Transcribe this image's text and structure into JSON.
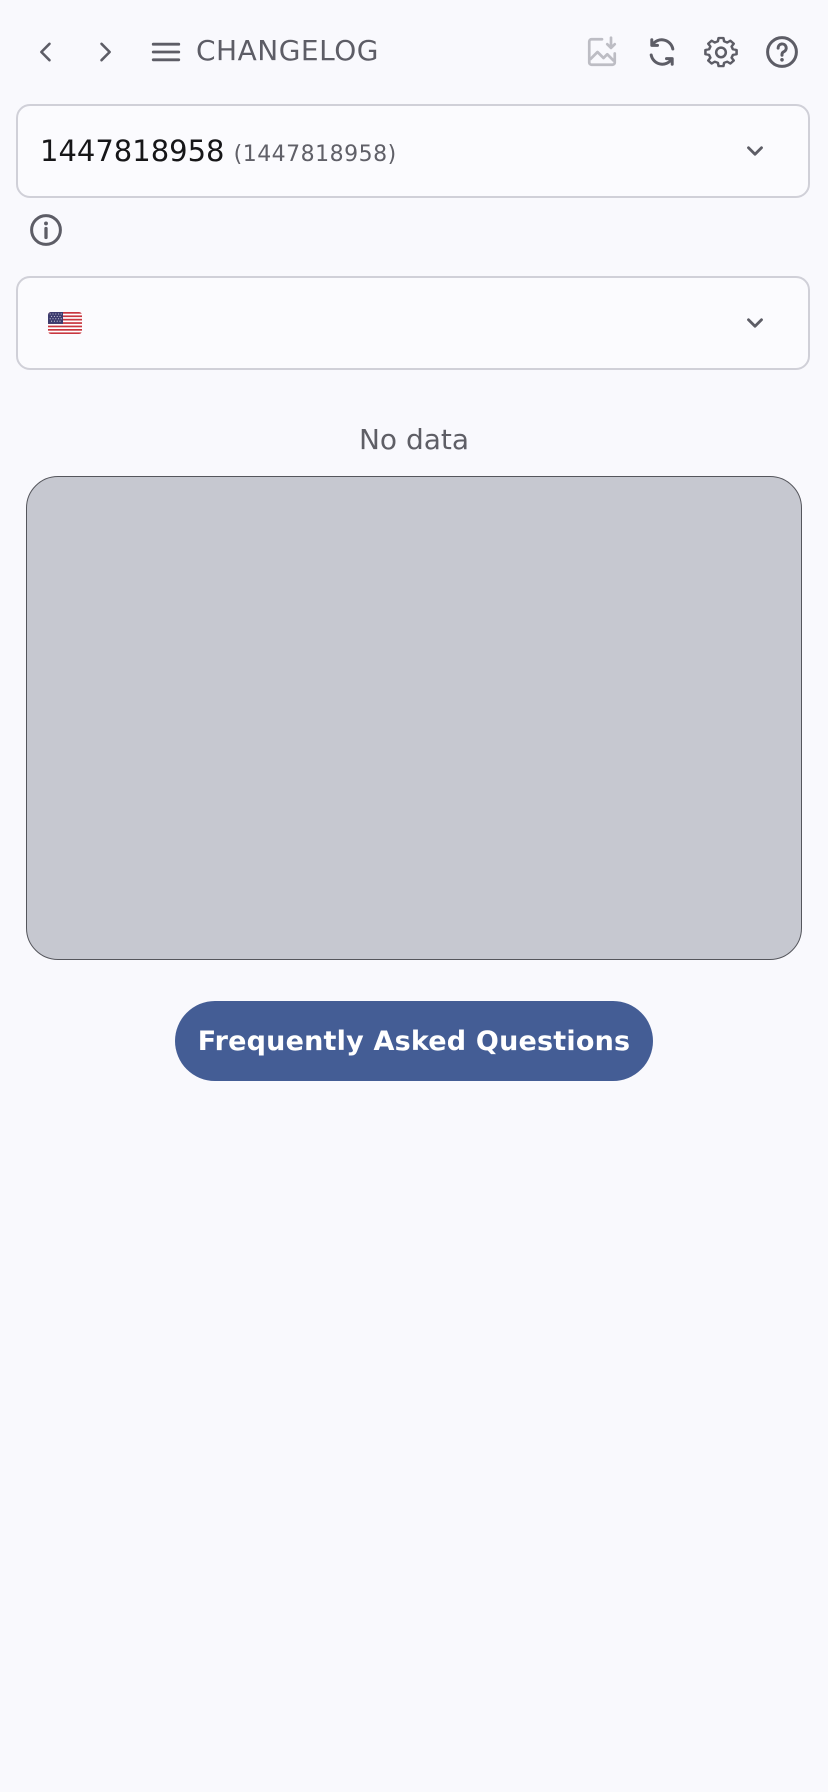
{
  "toolbar": {
    "title": "CHANGELOG",
    "icons": {
      "back": "chevron-left-icon",
      "forward": "chevron-right-icon",
      "menu": "hamburger-menu-icon",
      "download_image": "image-download-icon",
      "refresh": "refresh-icon",
      "settings": "gear-icon",
      "help": "help-circle-icon"
    }
  },
  "app_select": {
    "app_id": "1447818958",
    "app_id_secondary": "(1447818958)"
  },
  "country_select": {
    "flag": "us-flag-icon"
  },
  "main": {
    "status_text": "No data"
  },
  "faq_button": {
    "label": "Frequently Asked Questions"
  },
  "colors": {
    "background": "#f9f9fd",
    "accent": "#445d95",
    "panel": "#c6c8d0",
    "icon": "#5d5d66",
    "icon_disabled": "#bdbdc4"
  }
}
